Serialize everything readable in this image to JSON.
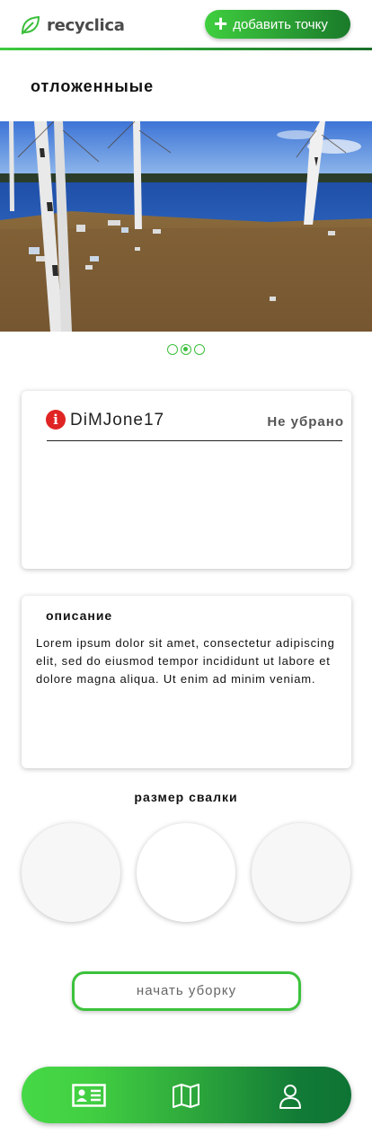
{
  "app": {
    "name": "recyclica"
  },
  "header": {
    "add_button_label": "добавить точку"
  },
  "section": {
    "title": "отложенныые"
  },
  "carousel": {
    "pages": 3,
    "active": 2
  },
  "report": {
    "username": "DiMJone17",
    "status": "Не убрано"
  },
  "description": {
    "title": "описание",
    "text": "Lorem ipsum dolor sit amet, consectetur adipiscing elit, sed do eiusmod tempor incididunt ut labore et dolore magna aliqua. Ut enim ad minim veniam."
  },
  "size": {
    "title": "размер свалки"
  },
  "actions": {
    "start_cleanup_label": "начать уборку"
  },
  "bottom_nav": {
    "items": [
      "id-card-icon",
      "map-icon",
      "user-icon"
    ]
  },
  "colors": {
    "accent": "#3ecb3e",
    "accent_dark": "#1a7a2a",
    "alert": "#e02424"
  }
}
